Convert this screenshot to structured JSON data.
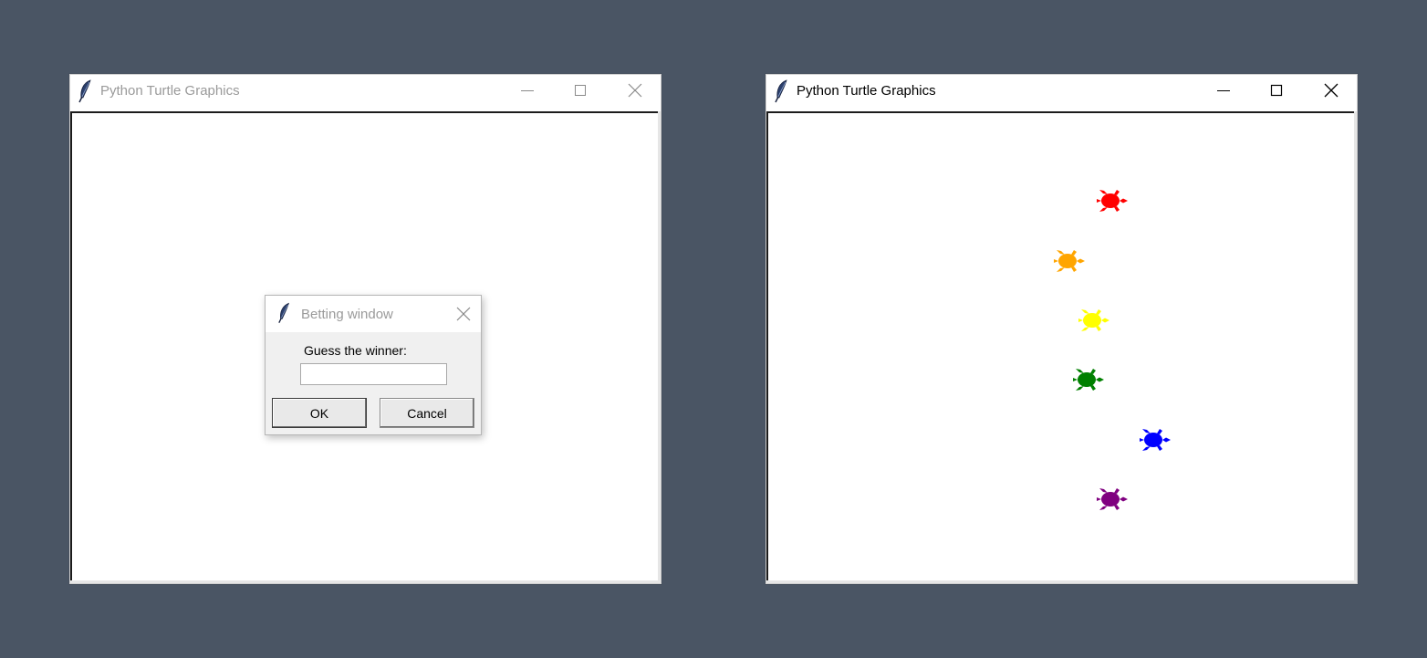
{
  "left_window": {
    "title": "Python Turtle Graphics"
  },
  "dialog": {
    "title": "Betting window",
    "prompt": "Guess the winner:",
    "input_value": "",
    "ok_label": "OK",
    "cancel_label": "Cancel"
  },
  "right_window": {
    "title": "Python Turtle Graphics",
    "turtles": [
      {
        "color": "#ff0000",
        "name": "red"
      },
      {
        "color": "#ffa500",
        "name": "orange"
      },
      {
        "color": "#ffff00",
        "name": "yellow"
      },
      {
        "color": "#008000",
        "name": "green"
      },
      {
        "color": "#0000ff",
        "name": "blue"
      },
      {
        "color": "#800080",
        "name": "purple"
      }
    ]
  },
  "icons": {
    "app_icon": "feather-icon",
    "minimize": "minimize-icon",
    "maximize": "maximize-icon",
    "close": "close-icon"
  }
}
